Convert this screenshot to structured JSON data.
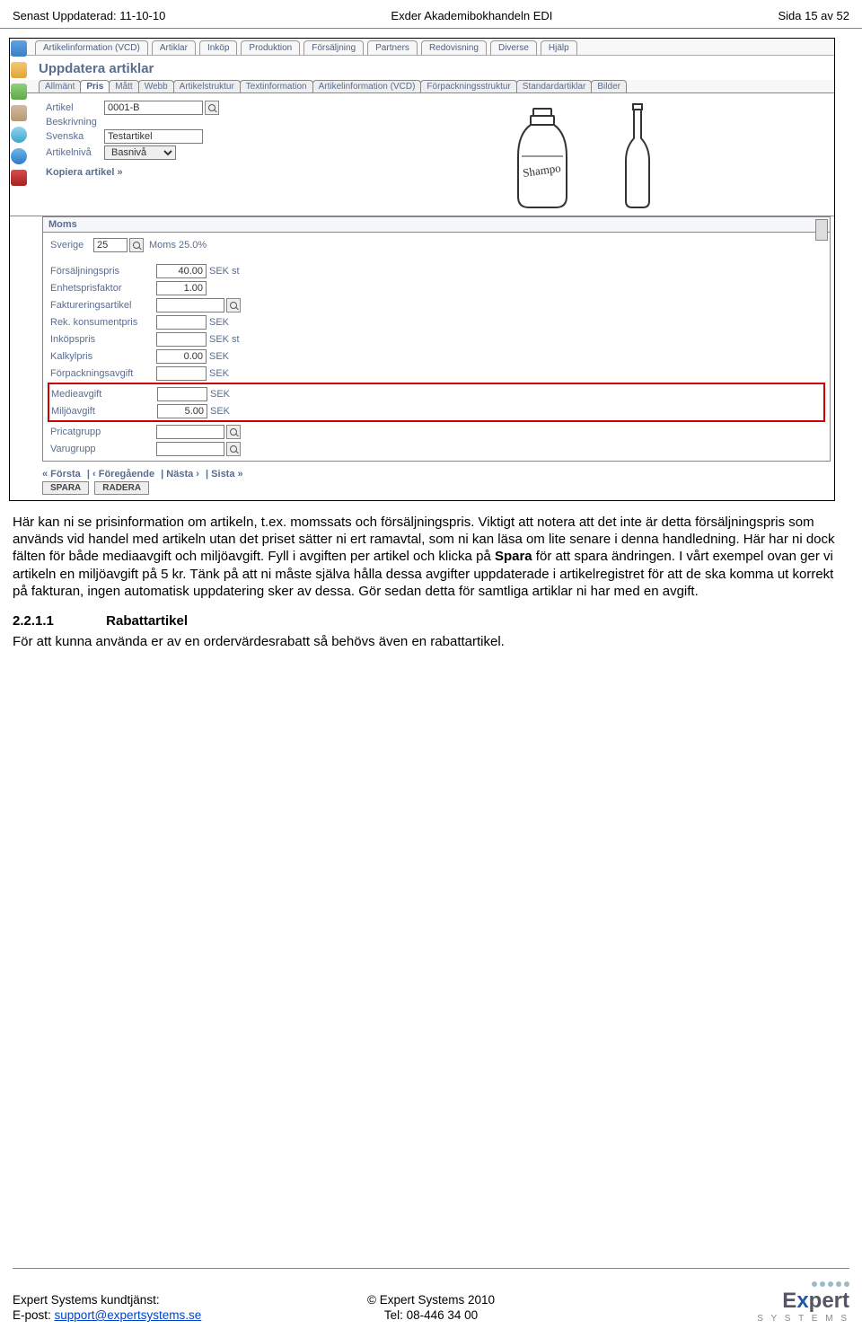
{
  "header": {
    "left": "Senast Uppdaterad: 11-10-10",
    "center": "Exder Akademibokhandeln EDI",
    "right": "Sida 15 av 52"
  },
  "topmenu": [
    "Artikelinformation (VCD)",
    "Artiklar",
    "Inköp",
    "Produktion",
    "Försäljning",
    "Partners",
    "Redovisning",
    "Diverse",
    "Hjälp"
  ],
  "page_title": "Uppdatera artiklar",
  "subtabs": [
    "Allmänt",
    "Pris",
    "Mått",
    "Webb",
    "Artikelstruktur",
    "Textinformation",
    "Artikelinformation (VCD)",
    "Förpackningsstruktur",
    "Standardartiklar",
    "Bilder"
  ],
  "active_subtab_index": 1,
  "form": {
    "artikel_label": "Artikel",
    "artikel_value": "0001-B",
    "beskrivning_label": "Beskrivning",
    "svenska_label": "Svenska",
    "svenska_value": "Testartikel",
    "artikelniva_label": "Artikelnivå",
    "artikelniva_value": "Basnivå",
    "copy_link": "Kopiera artikel »"
  },
  "moms": {
    "header": "Moms",
    "label": "Sverige",
    "code": "25",
    "desc": "Moms 25.0%"
  },
  "price_rows": [
    {
      "label": "Försäljningspris",
      "value": "40.00",
      "suffix": "SEK",
      "extra": "st"
    },
    {
      "label": "Enhetsprisfaktor",
      "value": "1.00",
      "suffix": "",
      "extra": ""
    },
    {
      "label": "Faktureringsartikel",
      "value": "",
      "suffix": "",
      "extra": "",
      "lookup": true
    },
    {
      "label": "Rek. konsumentpris",
      "value": "",
      "suffix": "SEK",
      "extra": ""
    },
    {
      "label": "Inköpspris",
      "value": "",
      "suffix": "SEK",
      "extra": "st"
    },
    {
      "label": "Kalkylpris",
      "value": "0.00",
      "suffix": "SEK",
      "extra": ""
    },
    {
      "label": "Förpackningsavgift",
      "value": "",
      "suffix": "SEK",
      "extra": ""
    }
  ],
  "highlight_rows": [
    {
      "label": "Medieavgift",
      "value": "",
      "suffix": "SEK"
    },
    {
      "label": "Miljöavgift",
      "value": "5.00",
      "suffix": "SEK"
    }
  ],
  "tail_rows": [
    {
      "label": "Pricatgrupp",
      "lookup": true
    },
    {
      "label": "Varugrupp",
      "lookup": true
    }
  ],
  "nav": {
    "first": "« Första",
    "prev": "‹ Föregående",
    "next": "Nästa ›",
    "last": "Sista »"
  },
  "buttons": {
    "save": "SPARA",
    "delete": "RADERA"
  },
  "body": {
    "p1a": "Här kan ni se prisinformation om artikeln, t.ex. momssats och försäljningspris.",
    "p1b_pre": "Viktigt att notera att det inte är detta försäljningspris som används vid handel med artikeln utan det priset sätter ni ert ramavtal, som ni kan läsa om lite senare i denna handledning. Här har ni dock fälten för både mediaavgift och miljöavgift. Fyll i avgiften per artikel och klicka på ",
    "p1b_bold": "Spara",
    "p1b_post": " för att spara ändringen. I vårt exempel ovan ger vi artikeln en miljöavgift på 5 kr. Tänk på att ni måste själva hålla dessa avgifter uppdaterade i artikelregistret för att de ska komma ut korrekt på fakturan, ingen automatisk uppdatering sker av dessa. Gör sedan detta för samtliga artiklar ni har med en avgift.",
    "sec_num": "2.2.1.1",
    "sec_title": "Rabattartikel",
    "p2": "För att kunna använda er av en ordervärdesrabatt så behövs även en rabattartikel."
  },
  "footer": {
    "l1": "Expert Systems kundtjänst:",
    "l2_pre": "E-post: ",
    "l2_link": "support@expertsystems.se",
    "c1": "© Expert Systems 2010",
    "c2": "Tel: 08-446 34 00",
    "logo_word_pre": "E",
    "logo_word_x": "x",
    "logo_word_post": "pert",
    "logo_sub": "S Y S T E M S"
  }
}
